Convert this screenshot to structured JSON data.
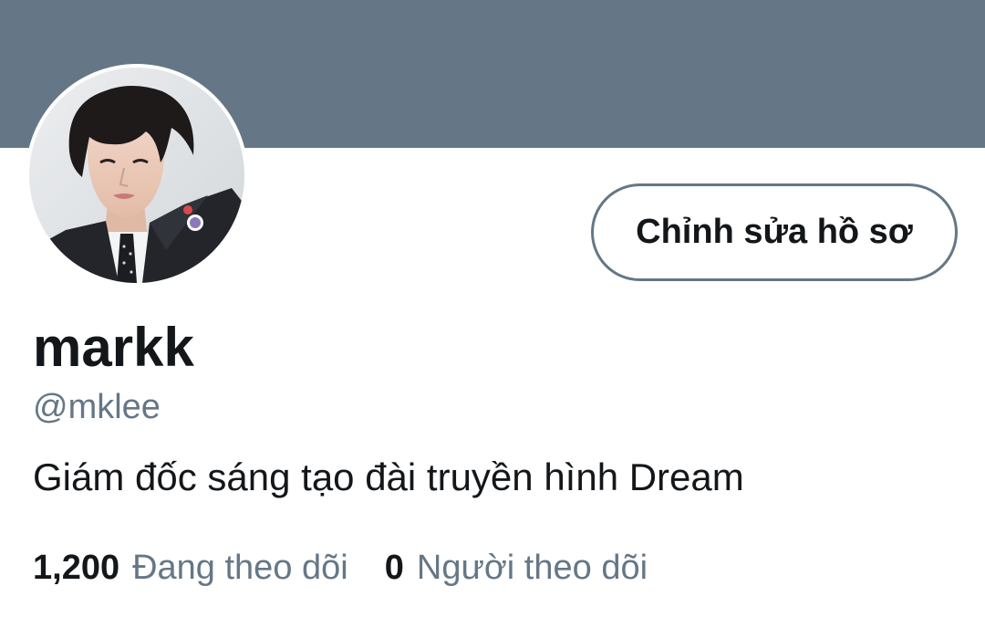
{
  "profile": {
    "edit_button_label": "Chỉnh sửa hồ sơ",
    "display_name": "markk",
    "handle": "@mklee",
    "bio": "Giám đốc sáng tạo đài truyền hình Dream"
  },
  "stats": {
    "following_count": "1,200",
    "following_label": "Đang theo dõi",
    "followers_count": "0",
    "followers_label": "Người theo dõi"
  },
  "colors": {
    "banner": "#657786",
    "text_primary": "#14171a",
    "text_secondary": "#657786",
    "button_border": "#657786"
  }
}
